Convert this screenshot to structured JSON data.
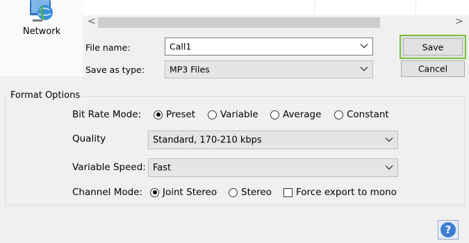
{
  "sidebar": {
    "network_label": "Network"
  },
  "file_list": {
    "scroll_left": "<",
    "scroll_right": ">"
  },
  "form": {
    "file_name_label": "File name:",
    "file_name_value": "Call1",
    "save_as_type_label": "Save as type:",
    "save_as_type_value": "MP3 Files",
    "save_button": "Save",
    "cancel_button": "Cancel"
  },
  "format_options": {
    "title": "Format Options",
    "bit_rate_mode_label": "Bit Rate Mode:",
    "bit_rate_options": [
      {
        "label": "Preset",
        "selected": true
      },
      {
        "label": "Variable",
        "selected": false
      },
      {
        "label": "Average",
        "selected": false
      },
      {
        "label": "Constant",
        "selected": false
      }
    ],
    "quality_label": "Quality",
    "quality_value": "Standard, 170-210 kbps",
    "variable_speed_label": "Variable Speed:",
    "variable_speed_value": "Fast",
    "channel_mode_label": "Channel Mode:",
    "channel_options": [
      {
        "label": "Joint Stereo",
        "selected": true
      },
      {
        "label": "Stereo",
        "selected": false
      }
    ],
    "force_mono_label": "Force export to mono",
    "force_mono_checked": false
  },
  "help": {
    "icon": "help-icon",
    "glyph": "?"
  },
  "colors": {
    "save_focus": "#7bbf3a",
    "help_blue": "#3f7fd3"
  }
}
